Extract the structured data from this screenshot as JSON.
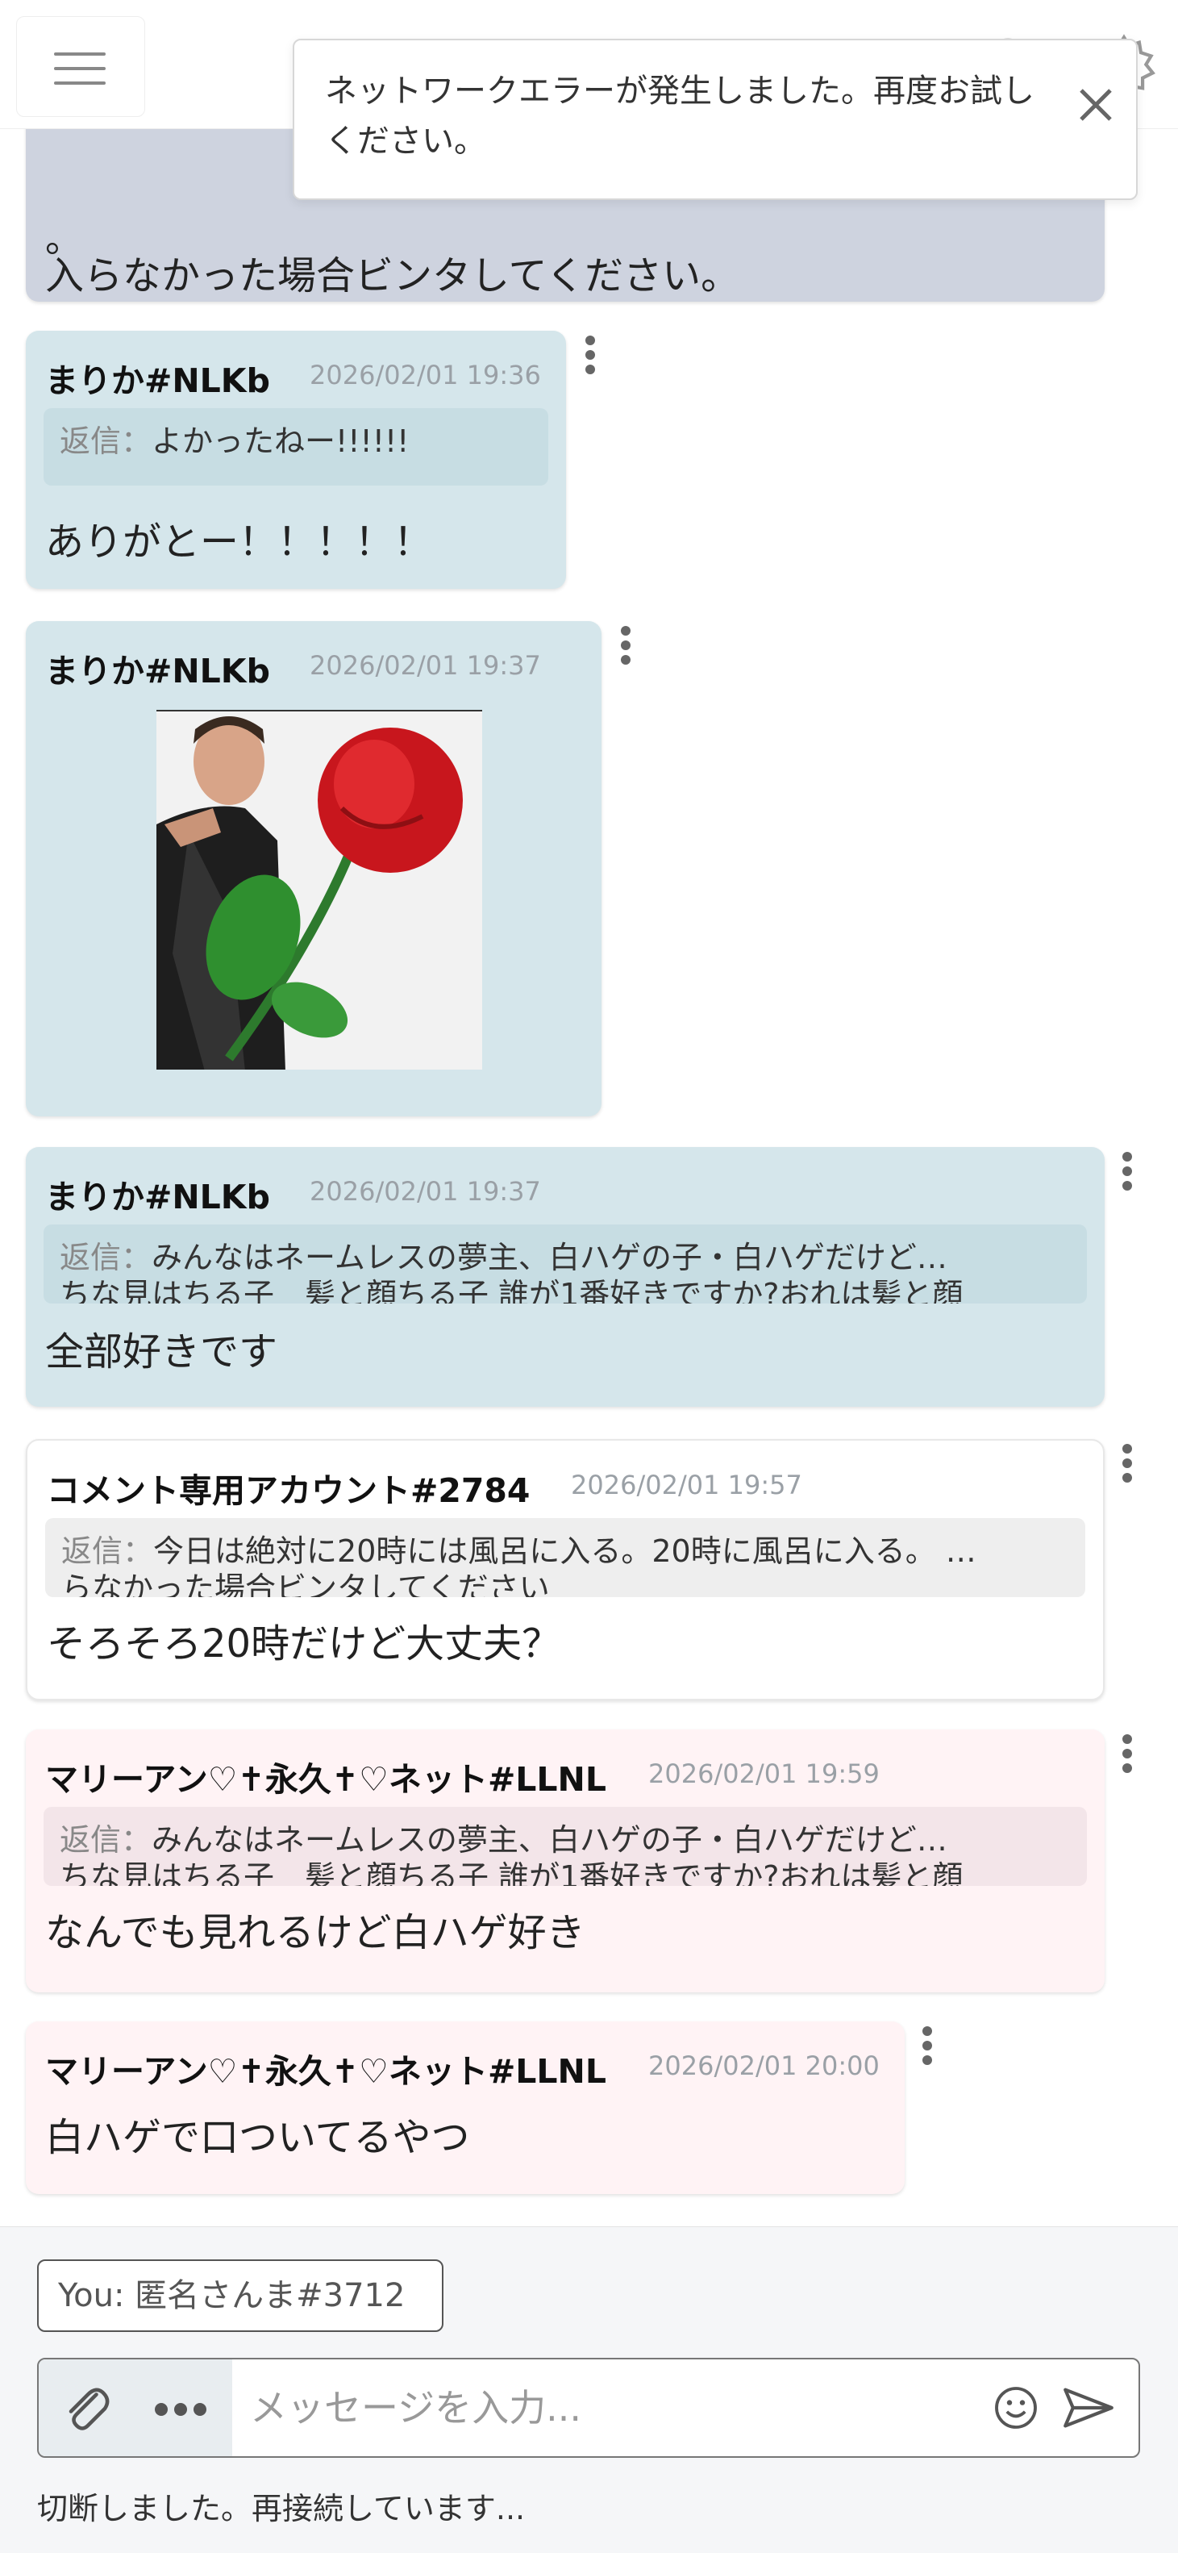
{
  "toast": {
    "message": "ネットワークエラーが発生しました。再度お試しください。"
  },
  "messages": [
    {
      "partial_line1": "。",
      "partial_line2": "入らなかった場合ビンタしてください。"
    },
    {
      "user": "まりか#NLKb",
      "time": "2026/02/01 19:36",
      "reply_label": "返信：",
      "reply_text": "よかったねー!!!!!!",
      "text": "ありがとー！！！！！"
    },
    {
      "user": "まりか#NLKb",
      "time": "2026/02/01 19:37"
    },
    {
      "user": "まりか#NLKb",
      "time": "2026/02/01 19:37",
      "reply_label": "返信：",
      "reply_text": "みんなはネームレスの夢主、白ハゲの子・白ハゲだけど…",
      "reply_text2": "ちな見はちる子　髪と顔ちる子 誰が1番好きですか?おれは髪と顔",
      "text": "全部好きです"
    },
    {
      "user": "コメント専用アカウント#2784",
      "time": "2026/02/01 19:57",
      "reply_label": "返信：",
      "reply_text": "今日は絶対に20時には風呂に入る。20時に風呂に入る。 …",
      "reply_text2": "らなかった場合ビンタしてください",
      "text": "そろそろ20時だけど大丈夫？"
    },
    {
      "user": "マリーアン♡✝永久✝♡ネット#LLNL",
      "time": "2026/02/01 19:59",
      "reply_label": "返信：",
      "reply_text": "みんなはネームレスの夢主、白ハゲの子・白ハゲだけど…",
      "reply_text2": "ちな見はちる子　髪と顔ちる子 誰が1番好きですか?おれは髪と顔",
      "text": "なんでも見れるけど白ハゲ好き"
    },
    {
      "user": "マリーアン♡✝永久✝♡ネット#LLNL",
      "time": "2026/02/01 20:00",
      "text": "白ハゲで口ついてるやつ"
    }
  ],
  "composer": {
    "you_label": "You: 匿名さんま#3712",
    "placeholder": "メッセージを入力...",
    "status": "切断しました。再接続しています..."
  },
  "icons": {
    "menu": "hamburger-icon",
    "close": "close-icon",
    "settings": "gear-icon",
    "attach": "paperclip-icon",
    "more": "more-icon",
    "emoji": "smiley-icon",
    "send": "send-icon",
    "kebab": "kebab-icon"
  },
  "colors": {
    "bubble_blue": "#d5e6eb",
    "bubble_gray": "#ced3df",
    "bubble_pink": "#fff3f5",
    "bubble_white": "#ffffff"
  }
}
